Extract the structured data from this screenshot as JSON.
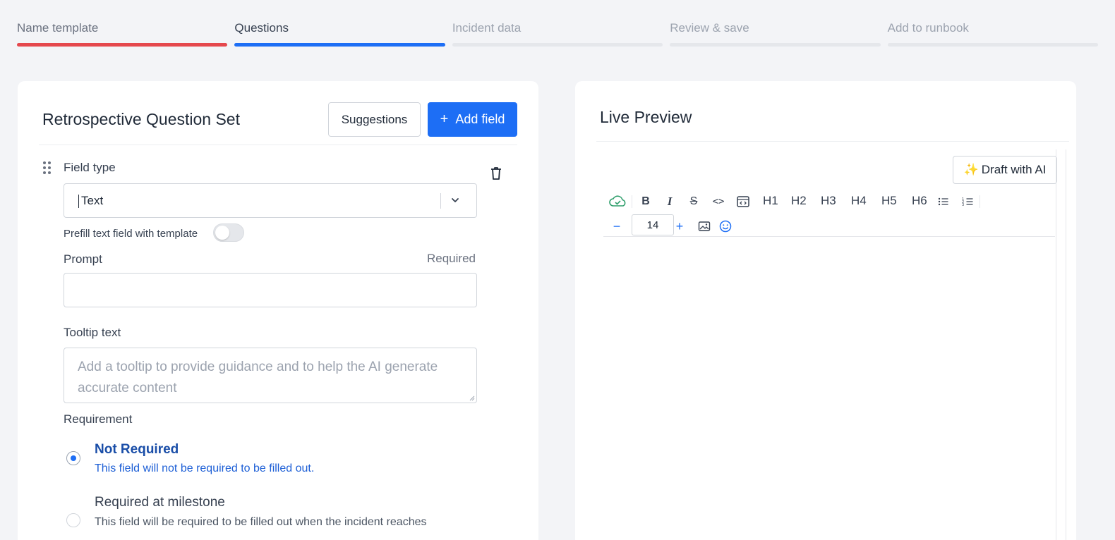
{
  "stepper": [
    {
      "label": "Name template",
      "state": "done"
    },
    {
      "label": "Questions",
      "state": "active"
    },
    {
      "label": "Incident data",
      "state": "todo"
    },
    {
      "label": "Review & save",
      "state": "todo"
    },
    {
      "label": "Add to runbook",
      "state": "todo"
    }
  ],
  "colors": {
    "accent": "#1d6ef5",
    "done": "#e5484d",
    "background": "#f3f4f7"
  },
  "left": {
    "title": "Retrospective Question Set",
    "suggestions_label": "Suggestions",
    "add_field_label": "Add field",
    "field_type_label": "Field type",
    "field_type_value": "Text",
    "prefill_label": "Prefill text field with template",
    "prefill_enabled": false,
    "prompt_label": "Prompt",
    "prompt_required_tag": "Required",
    "prompt_value": "",
    "tooltip_label": "Tooltip text",
    "tooltip_placeholder": "Add a tooltip to provide guidance and to help the AI generate accurate content",
    "requirement_label": "Requirement",
    "options": [
      {
        "title": "Not Required",
        "desc": "This field will not be required to be filled out.",
        "selected": true
      },
      {
        "title": "Required at milestone",
        "desc": "This field will be required to be filled out when the incident reaches",
        "selected": false
      }
    ]
  },
  "right": {
    "title": "Live Preview",
    "draft_label": "Draft with AI",
    "toolbar": {
      "headings": [
        "H1",
        "H2",
        "H3",
        "H4",
        "H5",
        "H6"
      ],
      "font_size": "14",
      "icons": [
        "cloud-saved-icon",
        "bold-icon",
        "italic-icon",
        "strikethrough-icon",
        "code-icon",
        "code-block-icon",
        "bullet-list-icon",
        "numbered-list-icon",
        "decrease-font-icon",
        "increase-font-icon",
        "image-icon",
        "emoji-icon"
      ]
    }
  }
}
